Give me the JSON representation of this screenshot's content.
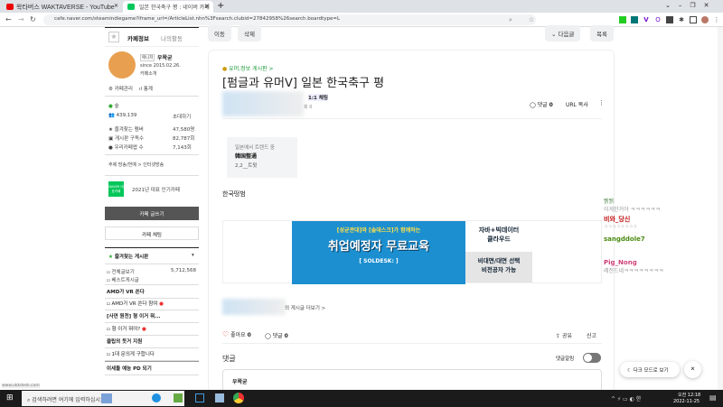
{
  "browser": {
    "tabs": [
      {
        "label": "왁타버스 WAKTAVERSE - YouTube"
      },
      {
        "label": "일본 한국축구 평 : 네이버 카페"
      }
    ],
    "new_tab": "+",
    "url": "cafe.naver.com/steamindiegame?iframe_url=/ArticleList.nhn%3Fsearch.clubid=27842958%26search.boardtype=L",
    "window_controls": [
      "⌄",
      "–",
      "❐",
      "✕"
    ]
  },
  "sidebar": {
    "tabs": [
      "카페정보",
      "나의활동"
    ],
    "manager_badge": "매니저",
    "manager_name": "우왁굳",
    "since": "since 2015.02.26.",
    "cafe_intro": "카페소개",
    "manage": "카페관리",
    "stats": "통계",
    "level": "숲",
    "members": "439,139",
    "invite": "초대하기",
    "stat_rows": [
      {
        "label": "즐겨찾는 멤버",
        "value": "47,580명"
      },
      {
        "label": "게시판 구독수",
        "value": "82,787회"
      },
      {
        "label": "우리카페앱 수",
        "value": "7,143회"
      }
    ],
    "topic": "주제  방송/연예 > 인터넷방송",
    "naver_badge": "NAVER 대표카페",
    "award": "2021년 대표 인기카페",
    "write_button": "카페 글쓰기",
    "chat_button": "카페 채팅",
    "fav_boards": "즐겨찾는 게시판",
    "all_posts": "전체글보기",
    "all_posts_count": "5,712,568",
    "best": "베스트게시글",
    "items": [
      {
        "head": "AMD가 VR 쏜다",
        "sub": "AMD가 VR 쏜다 참여"
      },
      {
        "head": "[사연 원천] 형 이거 뭐...",
        "sub": "형 이거 뭐야?"
      },
      {
        "head": "클립의 듯거 지원",
        "sub": "1대 문의게 구합니다"
      },
      {
        "head": "이세돌 예능 PD 되기",
        "sub": ""
      }
    ],
    "footer_url": "www.ukkdesk.com"
  },
  "toolbar": {
    "move": "이동",
    "delete": "삭제",
    "next": "다음글",
    "list": "목록"
  },
  "article": {
    "board": "유머,정보 게시판 >",
    "title": "[펌글과 유머ᐯ] 일본 한국축구 평",
    "chat_badge": "1:1 채팅",
    "views": "회 0",
    "comments_label": "댓글",
    "comments_count": "0",
    "url_copy": "URL 복사",
    "trend_caption": "일본에서 트렌드 중",
    "trend_title": "韓国整通",
    "trend_count": "2,2__트윗",
    "body": "한국떵범",
    "ad": {
      "line1": "[성균관대]와 [솔데스크]가 함께하는",
      "line2": "취업예정자 무료교육",
      "line3": "[ SOLDESK: ]",
      "right1": "자바+빅데이터",
      "right2": "클라우드",
      "right3": "비대면/대면 선택",
      "right4": "비전공자 가능"
    },
    "more_posts": "의 게시글 더보기 >",
    "like": "좋아요",
    "like_count": "0",
    "comment": "댓글",
    "comment_count": "0",
    "share": "공유",
    "report": "신고",
    "comment_section": "댓글",
    "comment_alarm": "댓글알림",
    "comment_author": "우왁굳"
  },
  "chat_overlay": [
    {
      "name": "쀍쀍",
      "msg": "이게한거야 ㅋㅋㅋㅋㅋㅋ",
      "color": "#6a9a6a"
    },
    {
      "name": "비와_당신",
      "msg": "ㅋㅋㅋㅋㅋㅋㅋㅋ",
      "color": "#c01010"
    },
    {
      "name": "sangddole7",
      "msg": "",
      "color": "#4a8a10"
    },
    {
      "name": "Pig_Nong",
      "msg": "레전드네ㅋㅋㅋㅋㅋㅋㅋㅋ",
      "color": "#d0407a"
    }
  ],
  "floating": {
    "dark_mode": "다크 모드로 보기",
    "top": "⌅"
  },
  "taskbar": {
    "search": "검색하려면 여기에 입력하십시오.",
    "time": "오전 12:18",
    "date": "2022-11-25"
  }
}
